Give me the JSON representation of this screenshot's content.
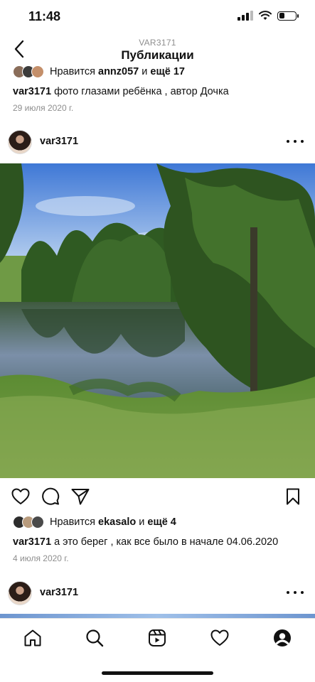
{
  "status_bar": {
    "time": "11:48"
  },
  "header": {
    "subtitle": "VAR3171",
    "title": "Публикации"
  },
  "post1": {
    "likes_prefix": "Нравится",
    "likes_user": "annz057",
    "likes_and": "и",
    "likes_more": "ещё 17",
    "caption_user": "var3171",
    "caption_text": "фото глазами ребёнка , автор Дочка",
    "date": "29 июля 2020 г."
  },
  "post2": {
    "username": "var3171",
    "likes_prefix": "Нравится",
    "likes_user": "ekasalo",
    "likes_and": "и",
    "likes_more": "ещё 4",
    "caption_user": "var3171",
    "caption_text": "а это берег , как все было в начале 04.06.2020",
    "date": "4 июля 2020 г.",
    "photo_icon": "lake-landscape-photo"
  },
  "post3": {
    "username": "var3171"
  },
  "icons": {
    "back": "chevron-left-icon",
    "like": "heart-icon",
    "comment": "comment-icon",
    "share": "paper-plane-icon",
    "save": "bookmark-icon",
    "more": "ellipsis-icon"
  },
  "tab_bar": {
    "items": [
      "home-icon",
      "search-icon",
      "reels-icon",
      "activity-heart-icon",
      "profile-icon"
    ]
  },
  "colors": {
    "text": "#111111",
    "secondary_text": "#8e8e8e",
    "sky": "#5d8fd9",
    "foliage": "#3f6d2f",
    "water": "#72869a"
  }
}
